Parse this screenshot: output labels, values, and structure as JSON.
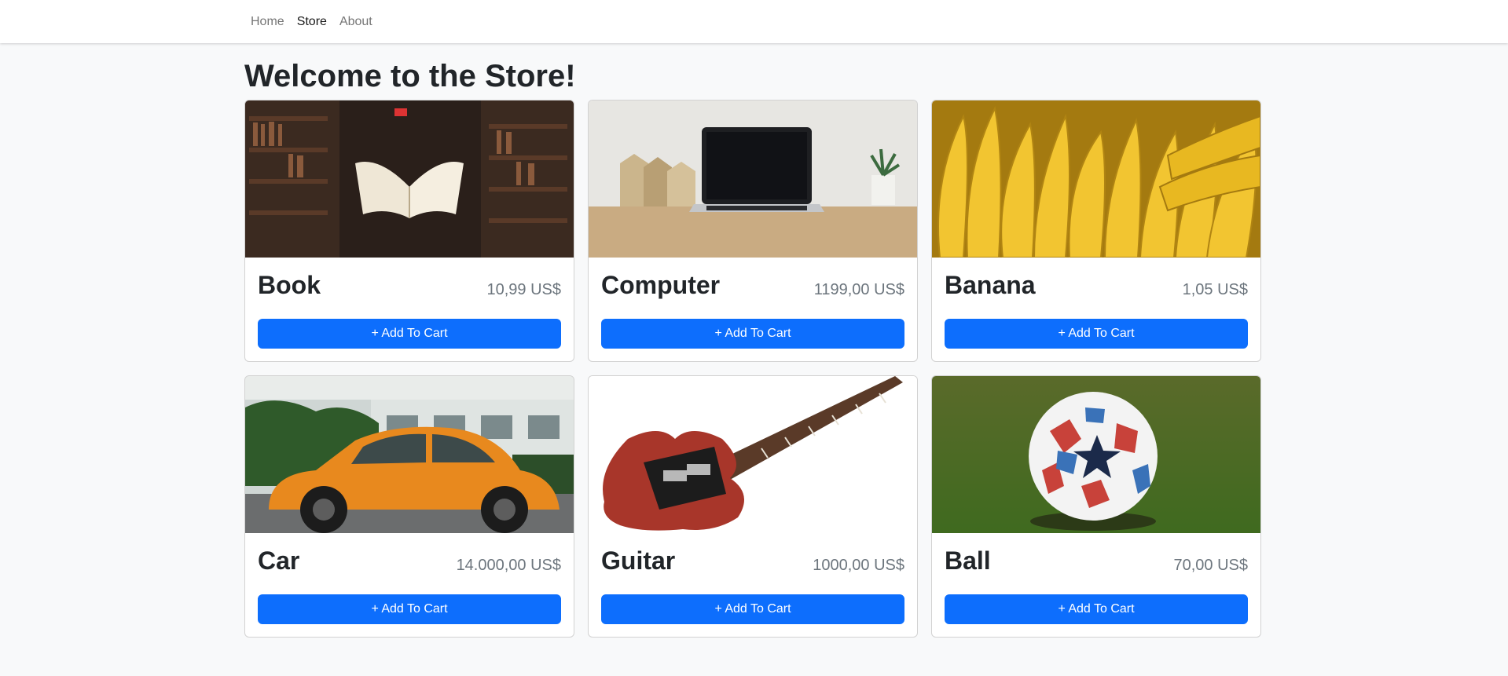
{
  "nav": {
    "links": [
      {
        "label": "Home",
        "active": false
      },
      {
        "label": "Store",
        "active": true
      },
      {
        "label": "About",
        "active": false
      }
    ]
  },
  "page": {
    "title": "Welcome to the Store!"
  },
  "products": [
    {
      "name": "Book",
      "price": "10,99 US$",
      "button": "+ Add To Cart",
      "image": "book-photo"
    },
    {
      "name": "Computer",
      "price": "1199,00 US$",
      "button": "+ Add To Cart",
      "image": "laptop-photo"
    },
    {
      "name": "Banana",
      "price": "1,05 US$",
      "button": "+ Add To Cart",
      "image": "banana-photo"
    },
    {
      "name": "Car",
      "price": "14.000,00 US$",
      "button": "+ Add To Cart",
      "image": "car-photo"
    },
    {
      "name": "Guitar",
      "price": "1000,00 US$",
      "button": "+ Add To Cart",
      "image": "guitar-photo"
    },
    {
      "name": "Ball",
      "price": "70,00 US$",
      "button": "+ Add To Cart",
      "image": "ball-photo"
    }
  ],
  "colors": {
    "primary": "#0d6efd",
    "background": "#f8f9fa",
    "price": "#6c757d"
  }
}
